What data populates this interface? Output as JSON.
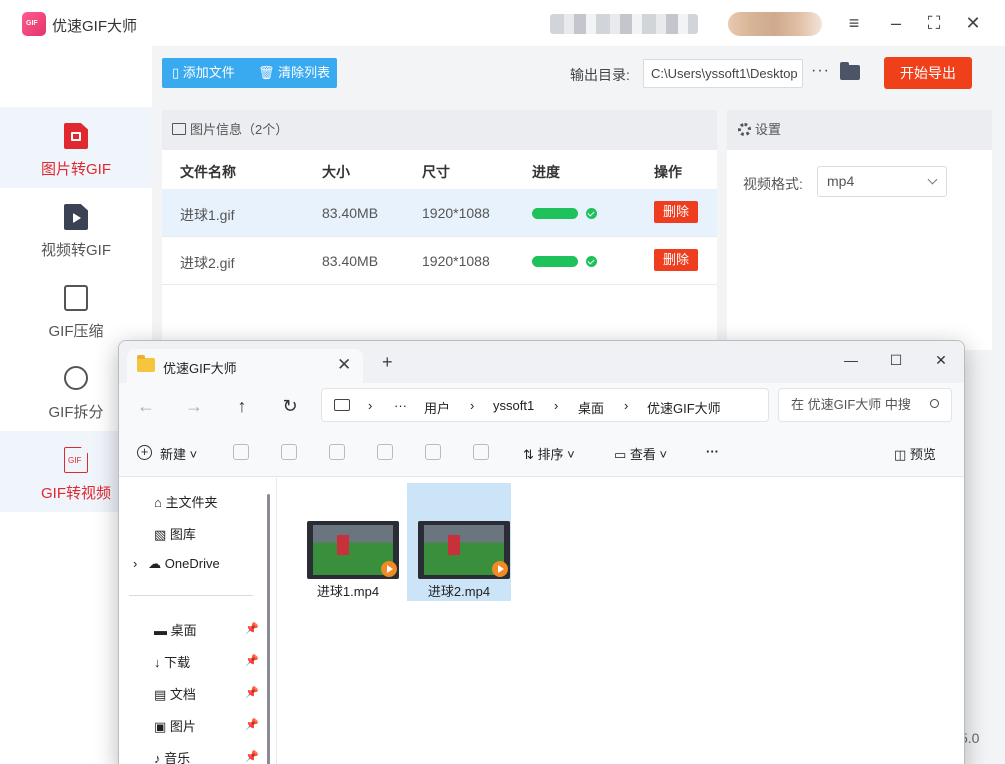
{
  "app": {
    "title": "优速GIF大师",
    "version": "5.0"
  },
  "sidebar": {
    "items": [
      {
        "label": "图片转GIF",
        "icon": "image-doc-icon",
        "active": true
      },
      {
        "label": "视频转GIF",
        "icon": "video-doc-icon",
        "active": false
      },
      {
        "label": "GIF压缩",
        "icon": "compress-icon",
        "active": false
      },
      {
        "label": "GIF拆分",
        "icon": "split-icon",
        "active": false
      },
      {
        "label": "GIF转视频",
        "icon": "gif-video-icon",
        "active": true
      }
    ]
  },
  "toolbar": {
    "add_file": "添加文件",
    "clear_list": "清除列表",
    "output_label": "输出目录:",
    "output_path": "C:\\Users\\yssoft1\\Desktop",
    "more": "···",
    "start_export": "开始导出"
  },
  "info_panel": {
    "title": "图片信息（2个）",
    "columns": [
      "文件名称",
      "大小",
      "尺寸",
      "进度",
      "操作"
    ],
    "rows": [
      {
        "name": "进球1.gif",
        "size": "83.40MB",
        "dimension": "1920*1088",
        "progress": 1.0,
        "action": "删除"
      },
      {
        "name": "进球2.gif",
        "size": "83.40MB",
        "dimension": "1920*1088",
        "progress": 1.0,
        "action": "删除"
      }
    ]
  },
  "settings": {
    "title": "设置",
    "format_label": "视频格式:",
    "format_value": "mp4"
  },
  "explorer": {
    "tab_title": "优速GIF大师",
    "breadcrumb": [
      "···",
      "用户",
      "yssoft1",
      "桌面",
      "优速GIF大师"
    ],
    "search_placeholder": "在 优速GIF大师 中搜",
    "commands": {
      "new": "新建",
      "sort": "排序",
      "view": "查看",
      "more": "···",
      "preview": "预览"
    },
    "nav_items": [
      {
        "label": "主文件夹",
        "icon": "home-icon"
      },
      {
        "label": "图库",
        "icon": "gallery-icon"
      },
      {
        "label": "OneDrive",
        "icon": "cloud-icon"
      },
      {
        "label": "桌面",
        "icon": "desktop-icon"
      },
      {
        "label": "下载",
        "icon": "download-icon"
      },
      {
        "label": "文档",
        "icon": "document-icon"
      },
      {
        "label": "图片",
        "icon": "pictures-icon"
      },
      {
        "label": "音乐",
        "icon": "music-icon"
      }
    ],
    "files": [
      {
        "name": "进球1.mp4",
        "selected": false
      },
      {
        "name": "进球2.mp4",
        "selected": true
      }
    ]
  },
  "colors": {
    "accent_red": "#e0282e",
    "button_blue": "#3aaaf0",
    "progress_green": "#1fc15a",
    "delete_red": "#ee3e1f",
    "start_orange": "#f0401a"
  }
}
